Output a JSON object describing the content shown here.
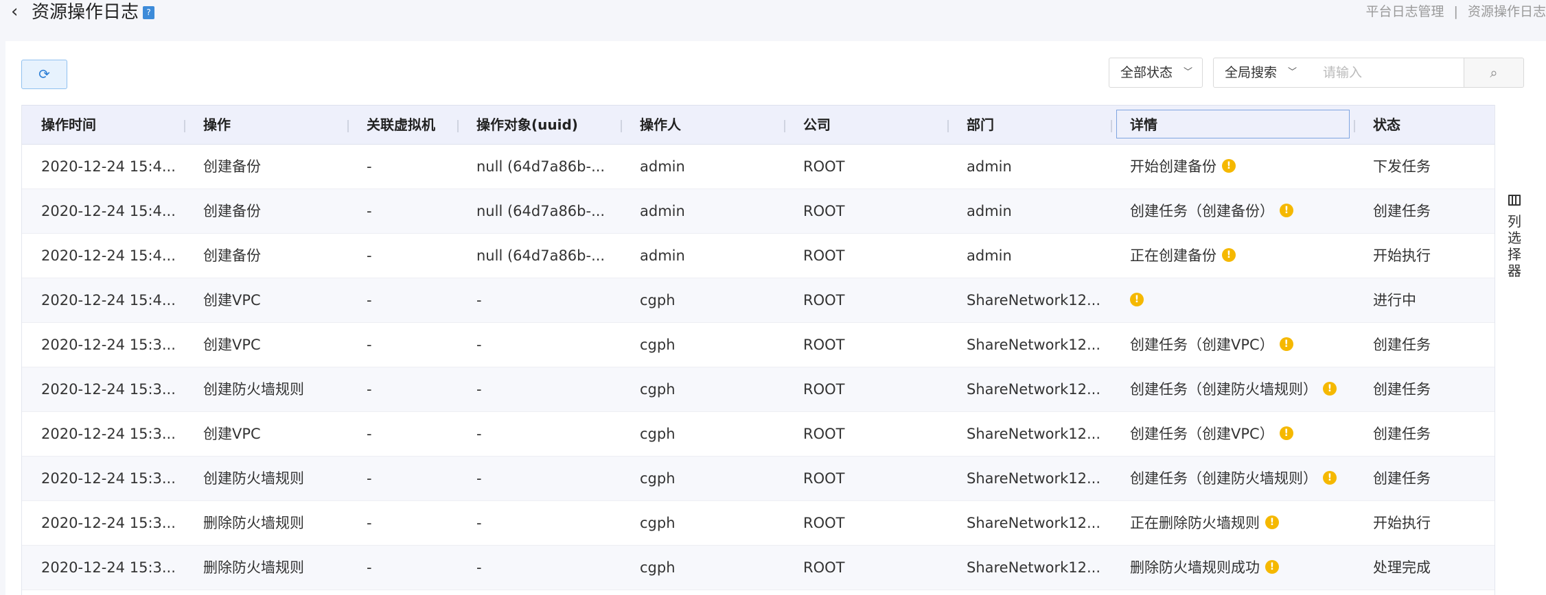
{
  "header": {
    "title": "资源操作日志",
    "help_icon": "?",
    "breadcrumb": [
      "平台日志管理",
      "资源操作日志"
    ],
    "breadcrumb_sep": "|"
  },
  "toolbar": {
    "refresh_icon": "⟳",
    "status_filter": "全部状态",
    "search_scope": "全局搜索",
    "search_placeholder": "请输入",
    "search_icon": "⌕"
  },
  "table": {
    "columns": [
      "操作时间",
      "操作",
      "关联虚拟机",
      "操作对象(uuid)",
      "操作人",
      "公司",
      "部门",
      "详情",
      "状态"
    ],
    "rows": [
      {
        "time": "2020-12-24 15:4...",
        "op": "创建备份",
        "vm": "-",
        "target": "null (64d7a86b-...",
        "user": "admin",
        "company": "ROOT",
        "dept": "admin",
        "detail": "开始创建备份",
        "status": "下发任务"
      },
      {
        "time": "2020-12-24 15:4...",
        "op": "创建备份",
        "vm": "-",
        "target": "null (64d7a86b-...",
        "user": "admin",
        "company": "ROOT",
        "dept": "admin",
        "detail": "创建任务（创建备份）",
        "status": "创建任务"
      },
      {
        "time": "2020-12-24 15:4...",
        "op": "创建备份",
        "vm": "-",
        "target": "null (64d7a86b-...",
        "user": "admin",
        "company": "ROOT",
        "dept": "admin",
        "detail": "正在创建备份",
        "status": "开始执行"
      },
      {
        "time": "2020-12-24 15:4...",
        "op": "创建VPC",
        "vm": "-",
        "target": "-",
        "user": "cgph",
        "company": "ROOT",
        "dept": "ShareNetwork12...",
        "detail": "",
        "status": "进行中"
      },
      {
        "time": "2020-12-24 15:3...",
        "op": "创建VPC",
        "vm": "-",
        "target": "-",
        "user": "cgph",
        "company": "ROOT",
        "dept": "ShareNetwork12...",
        "detail": "创建任务（创建VPC）",
        "status": "创建任务"
      },
      {
        "time": "2020-12-24 15:3...",
        "op": "创建防火墙规则",
        "vm": "-",
        "target": "-",
        "user": "cgph",
        "company": "ROOT",
        "dept": "ShareNetwork12...",
        "detail": "创建任务（创建防火墙规则）",
        "status": "创建任务"
      },
      {
        "time": "2020-12-24 15:3...",
        "op": "创建VPC",
        "vm": "-",
        "target": "-",
        "user": "cgph",
        "company": "ROOT",
        "dept": "ShareNetwork12...",
        "detail": "创建任务（创建VPC）",
        "status": "创建任务"
      },
      {
        "time": "2020-12-24 15:3...",
        "op": "创建防火墙规则",
        "vm": "-",
        "target": "-",
        "user": "cgph",
        "company": "ROOT",
        "dept": "ShareNetwork12...",
        "detail": "创建任务（创建防火墙规则）",
        "status": "创建任务"
      },
      {
        "time": "2020-12-24 15:3...",
        "op": "删除防火墙规则",
        "vm": "-",
        "target": "-",
        "user": "cgph",
        "company": "ROOT",
        "dept": "ShareNetwork12...",
        "detail": "正在删除防火墙规则",
        "status": "开始执行"
      },
      {
        "time": "2020-12-24 15:3...",
        "op": "删除防火墙规则",
        "vm": "-",
        "target": "-",
        "user": "cgph",
        "company": "ROOT",
        "dept": "ShareNetwork12...",
        "detail": "删除防火墙规则成功",
        "status": "处理完成"
      }
    ],
    "detail_icon": "!"
  },
  "column_chooser": {
    "label": "列选择器"
  },
  "colors": {
    "accent": "#2d7fd6",
    "warning": "#f5b800",
    "header_bg": "#eef0fb"
  }
}
